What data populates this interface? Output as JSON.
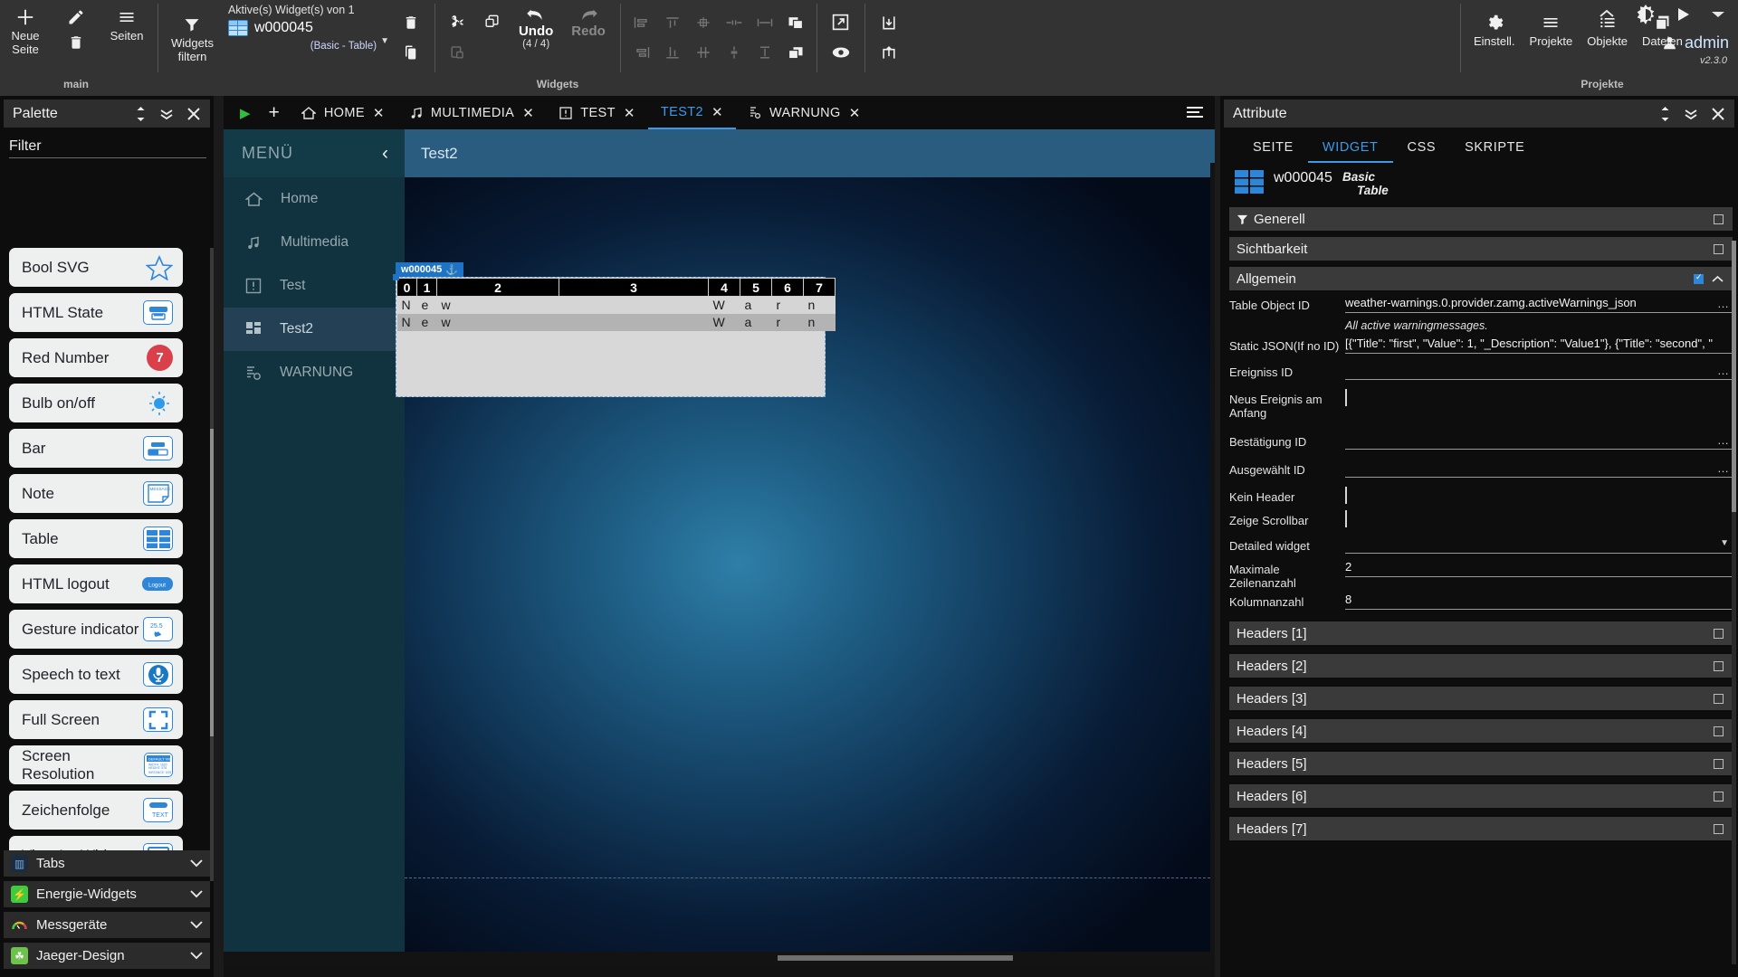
{
  "ribbon": {
    "pages_group": {
      "caption": "main",
      "new_page": "Neue\nSeite",
      "new_page_l1": "Neue",
      "new_page_l2": "Seite",
      "pages": "Seiten"
    },
    "widgets_group": {
      "caption": "Widgets",
      "filter_l1": "Widgets",
      "filter_l2": "filtern",
      "active_label": "Aktive(s) Widget(s) von 1",
      "widget_name": "w000045",
      "widget_type": "(Basic - Table)",
      "undo_label": "Undo",
      "undo_count": "(4 / 4)",
      "redo_label": "Redo"
    },
    "projects_group": {
      "caption": "Projekte",
      "items": [
        {
          "label": "Einstell.",
          "icon": "gear-icon"
        },
        {
          "label": "Projekte",
          "icon": "menu-icon"
        },
        {
          "label": "Objekte",
          "icon": "list-icon"
        },
        {
          "label": "Dateien",
          "icon": "copy-icon"
        }
      ]
    },
    "account": {
      "user": "admin",
      "version": "v2.3.0"
    }
  },
  "palette": {
    "title": "Palette",
    "filter_label": "Filter",
    "items": [
      {
        "label": "Bool SVG",
        "icon": "star-icon"
      },
      {
        "label": "HTML State",
        "icon": "html-state-icon"
      },
      {
        "label": "Red Number",
        "icon": "red-badge-icon",
        "badge": "7"
      },
      {
        "label": "Bulb on/off",
        "icon": "bulb-icon"
      },
      {
        "label": "Bar",
        "icon": "bar-icon"
      },
      {
        "label": "Note",
        "icon": "note-icon",
        "icon_text": "MESSAGE"
      },
      {
        "label": "Table",
        "icon": "table-icon"
      },
      {
        "label": "HTML logout",
        "icon": "logout-icon",
        "icon_text": "Logout"
      },
      {
        "label": "Gesture indicator",
        "icon": "gesture-icon",
        "icon_text": "25.5"
      },
      {
        "label": "Speech to text",
        "icon": "microphone-icon"
      },
      {
        "label": "Full Screen",
        "icon": "fullscreen-icon"
      },
      {
        "label": "Screen Resolution",
        "icon": "screen-resolution-icon"
      },
      {
        "label": "Zeichenfolge",
        "icon": "text-icon",
        "icon_text": "TEXT"
      },
      {
        "label": "View Im Widget",
        "icon": "monitor-icon"
      }
    ],
    "categories": [
      {
        "label": "Tabs",
        "icon": "tabs-icon",
        "color": "#2b4a7a"
      },
      {
        "label": "Energie-Widgets",
        "icon": "bolt-icon",
        "color": "#3ecb3e"
      },
      {
        "label": "Messgeräte",
        "icon": "gauge-icon",
        "color": "#2a2a2a"
      },
      {
        "label": "Jaeger-Design",
        "icon": "leaf-icon",
        "color": "#6cc24a"
      }
    ]
  },
  "editor": {
    "tabs": [
      {
        "label": "HOME",
        "icon": "home-icon",
        "active": false
      },
      {
        "label": "MULTIMEDIA",
        "icon": "music-icon",
        "active": false
      },
      {
        "label": "TEST",
        "icon": "alert-icon",
        "active": false
      },
      {
        "label": "TEST2",
        "icon": "",
        "active": true
      },
      {
        "label": "WARNUNG",
        "icon": "warning-icon",
        "active": false
      }
    ],
    "close_glyph": "✕",
    "menu": {
      "title": "MENÜ",
      "collapse_glyph": "‹",
      "items": [
        {
          "label": "Home",
          "icon": "home-icon",
          "selected": false
        },
        {
          "label": "Multimedia",
          "icon": "music-icon",
          "selected": false
        },
        {
          "label": "Test",
          "icon": "alert-icon",
          "selected": false
        },
        {
          "label": "Test2",
          "icon": "grid-icon",
          "selected": true
        },
        {
          "label": "WARNUNG",
          "icon": "warning-icon",
          "selected": false
        }
      ]
    },
    "page_title": "Test2",
    "widget": {
      "tag": "w000045",
      "anchor_glyph": "⚓",
      "headers": [
        "0",
        "1",
        "2",
        "3",
        "4",
        "5",
        "6",
        "7"
      ],
      "rows": [
        [
          "N",
          "e",
          "w",
          "",
          "W",
          "a",
          "r",
          "n"
        ],
        [
          "N",
          "e",
          "w",
          "",
          "W",
          "a",
          "r",
          "n"
        ]
      ]
    }
  },
  "attribute": {
    "title": "Attribute",
    "tabs": [
      {
        "label": "SEITE",
        "active": false
      },
      {
        "label": "WIDGET",
        "active": true
      },
      {
        "label": "CSS",
        "active": false
      },
      {
        "label": "SKRIPTE",
        "active": false
      }
    ],
    "widget_name": "w000045",
    "widget_kind": "Basic",
    "widget_kind2": "Table",
    "sections": [
      {
        "label": "Generell",
        "icon": "filter-icon",
        "checked": false
      },
      {
        "label": "Sichtbarkeit",
        "icon": "",
        "checked": false
      },
      {
        "label": "Allgemein",
        "icon": "",
        "checked": true,
        "expanded": true
      }
    ],
    "properties": [
      {
        "label": "Table Object ID",
        "value": "weather-warnings.0.provider.zamg.activeWarnings_json",
        "dots": "…",
        "type": "text"
      },
      {
        "label": "",
        "value": "All active warningmessages.",
        "type": "hint"
      },
      {
        "label": "Static JSON(If no ID)",
        "value": "[{\"Title\": \"first\", \"Value\": 1, \"_Description\": \"Value1\"}, {\"Title\": \"second\", \"",
        "type": "text"
      },
      {
        "label": "Ereigniss ID",
        "value": "",
        "dots": "…",
        "type": "text"
      },
      {
        "label": "Neus Ereignis am Anfang",
        "value": "",
        "type": "checkbox",
        "checked": false
      },
      {
        "label": "Bestätigung ID",
        "value": "",
        "dots": "…",
        "type": "text"
      },
      {
        "label": "Ausgewählt ID",
        "value": "",
        "dots": "…",
        "type": "text"
      },
      {
        "label": "Kein Header",
        "value": "",
        "type": "checkbox",
        "checked": false
      },
      {
        "label": "Zeige Scrollbar",
        "value": "",
        "type": "checkbox",
        "checked": false
      },
      {
        "label": "Detailed widget",
        "value": "",
        "type": "select"
      },
      {
        "label": "Maximale Zeilenanzahl",
        "value": "2",
        "type": "text"
      },
      {
        "label": "Kolumnanzahl",
        "value": "8",
        "type": "text"
      }
    ],
    "header_sections": [
      "Headers [1]",
      "Headers [2]",
      "Headers [3]",
      "Headers [4]",
      "Headers [5]",
      "Headers [6]",
      "Headers [7]"
    ]
  },
  "colors": {
    "accent": "#3d9ae8",
    "ribbon_bg": "#333333",
    "panel_bg": "#0d0d0d",
    "menu_bg": "#10333f",
    "selected_menu": "#234055",
    "red_badge": "#d9404a",
    "green_play": "#2fbe3f"
  }
}
